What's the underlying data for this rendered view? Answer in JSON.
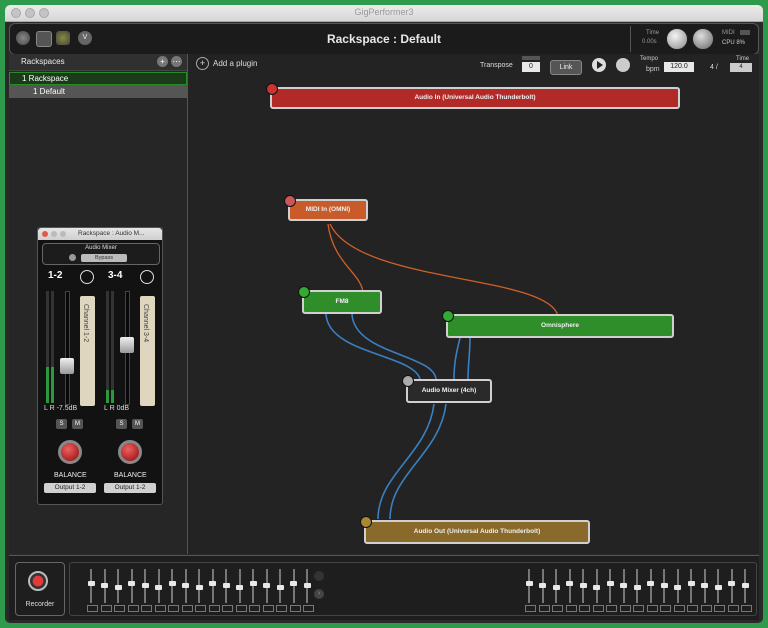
{
  "window": {
    "title": "GigPerformer3"
  },
  "topbar": {
    "rackspace_title": "Rackspace : Default",
    "time_label": "Time",
    "clock_label": "0.00s",
    "midi_label": "MIDI",
    "cpu_label": "CPU 8%"
  },
  "toolbar": {
    "add_plugin": "Add a plugin",
    "transpose_label": "Transpose",
    "transpose_value": "0",
    "link_label": "Link",
    "tempo_label": "Tempo",
    "bpm_label": "bpm",
    "tempo_value": "120.0",
    "time_sig_label": "Time",
    "time_sig_num": "4 /",
    "time_sig_den": "4"
  },
  "sidebar": {
    "title": "Rackspaces",
    "rackspace": "1 Rackspace",
    "variation": "1 Default"
  },
  "mixer_window": {
    "title": "Rackspace : Audio M...",
    "plugin_name": "Audio Mixer",
    "bypass": "Bypass",
    "channels": [
      {
        "name": "1-2",
        "strip": "Channel 1-2",
        "level": "L R -7.5dB",
        "solo": "S",
        "mute": "M",
        "balance": "BALANCE",
        "output": "Output 1-2",
        "meter_fraction": 0.32,
        "fader_fraction": 0.3
      },
      {
        "name": "3-4",
        "strip": "Channel 3-4",
        "level": "L R 0dB",
        "solo": "S",
        "mute": "M",
        "balance": "BALANCE",
        "output": "Output 1-2",
        "meter_fraction": 0.12,
        "fader_fraction": 0.52
      }
    ]
  },
  "nodes": {
    "audio_in": "Audio In (Universal Audio Thunderbolt)",
    "midi_in": "MIDI In (OMNI)",
    "fm8": "FM8",
    "omnisphere": "Omnisphere",
    "audio_mixer": "Audio Mixer (4ch)",
    "audio_out": "Audio Out (Universal Audio Thunderbolt)"
  },
  "colors": {
    "audio_in": "#b22a28",
    "midi_in": "#c95a2a",
    "fm8": "#2f8e2a",
    "omnisphere": "#2f8e2a",
    "audio_mixer": "#2a2a2a",
    "audio_out": "#8a6a2a",
    "audio_wire": "#3a7fc0",
    "midi_wire": "#d0602a"
  },
  "bottom": {
    "recorder": "Recorder"
  }
}
